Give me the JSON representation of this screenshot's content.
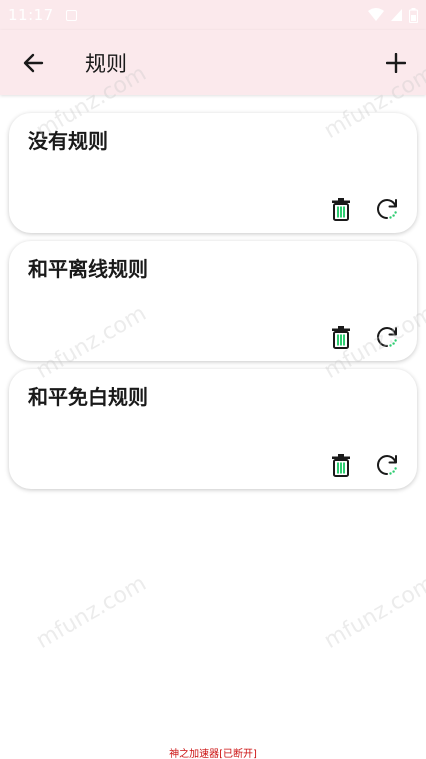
{
  "status_bar": {
    "time": "11:17"
  },
  "app_bar": {
    "title": "规则"
  },
  "rules": [
    {
      "name": "没有规则"
    },
    {
      "name": "和平离线规则"
    },
    {
      "name": "和平免白规则"
    }
  ],
  "watermark_text": "mfunz.com",
  "footer_status": "神之加速器[已断开]",
  "colors": {
    "app_bar_bg": "#fbe9ec",
    "accent_green": "#2ecc71",
    "footer_red": "#cc1111"
  }
}
